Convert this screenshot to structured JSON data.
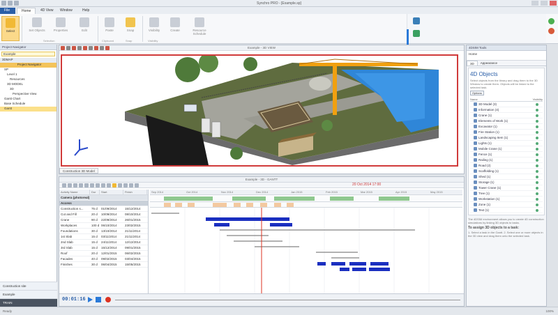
{
  "window": {
    "title": "Synchro PRO - [Example.sp]"
  },
  "ribbon": {
    "tabs": [
      "File",
      "Home",
      "4D View",
      "Window",
      "Help"
    ],
    "active_tab": "Home",
    "buttons": [
      "Select",
      "Set Objects",
      "Properties",
      "Edit",
      "Paste",
      "Snap",
      "Visibility",
      "Create",
      "Resource Schedule"
    ],
    "groups": [
      "Selection",
      "Clipboard",
      "Snap",
      "Visibility"
    ]
  },
  "left_panel": {
    "header": "Project Navigator",
    "search_value": "Example",
    "tree": [
      "3DMAP",
      "Project Navigator",
      "SP",
      "Level 1",
      "Resources",
      "3D MODEL",
      "3D",
      "Perspective View",
      "Gantt Chart",
      "Base Schedule",
      "Gantt"
    ],
    "bottom": [
      "Construction site",
      "Example",
      "TRAIN"
    ]
  },
  "view3d": {
    "title": "Example - 3D VIEW",
    "tab_label": "Construction 3D Model"
  },
  "gantt": {
    "title": "Example - 3D - GANTT",
    "current_date": "20 Oct 2014 17:00",
    "timecode": "00:01:16",
    "columns": [
      "Activity Name",
      "Dur",
      "Start",
      "Finish"
    ],
    "rows": [
      {
        "name": "Camera (photoreal)",
        "dur": "",
        "start": "",
        "finish": "",
        "style": "grp"
      },
      {
        "name": "Access",
        "dur": "",
        "start": "",
        "finish": "",
        "style": "sub"
      },
      {
        "name": "Construction s...",
        "dur": "75 d",
        "start": "01/09/2014",
        "finish": "15/12/2014",
        "style": ""
      },
      {
        "name": "Cut and Fill",
        "dur": "20 d",
        "start": "10/09/2014",
        "finish": "08/10/2014",
        "style": ""
      },
      {
        "name": "Crane",
        "dur": "90 d",
        "start": "22/09/2014",
        "finish": "26/01/2015",
        "style": ""
      },
      {
        "name": "Workplaces",
        "dur": "100 d",
        "start": "06/10/2014",
        "finish": "23/02/2015",
        "style": ""
      },
      {
        "name": "Foundations",
        "dur": "30 d",
        "start": "13/10/2014",
        "finish": "21/11/2014",
        "style": ""
      },
      {
        "name": "1st Slab",
        "dur": "15 d",
        "start": "03/11/2014",
        "finish": "21/11/2014",
        "style": ""
      },
      {
        "name": "2nd Slab",
        "dur": "15 d",
        "start": "24/11/2014",
        "finish": "12/12/2014",
        "style": ""
      },
      {
        "name": "3rd Slab",
        "dur": "15 d",
        "start": "15/12/2014",
        "finish": "09/01/2015",
        "style": ""
      },
      {
        "name": "Roof",
        "dur": "20 d",
        "start": "12/01/2015",
        "finish": "06/02/2015",
        "style": ""
      },
      {
        "name": "Facades",
        "dur": "40 d",
        "start": "09/02/2015",
        "finish": "03/04/2015",
        "style": ""
      },
      {
        "name": "Finishes",
        "dur": "30 d",
        "start": "06/04/2015",
        "finish": "15/05/2015",
        "style": ""
      }
    ],
    "months": [
      "Sep 2014",
      "Oct 2014",
      "Nov 2014",
      "Dec 2014",
      "Jan 2015",
      "Feb 2015",
      "Mar 2015",
      "Apr 2015",
      "May 2015"
    ]
  },
  "right_panel": {
    "header": "4DSIM Tools",
    "home_label": "Home",
    "tabs": [
      "3D",
      "Appearance"
    ],
    "title": "4D Objects",
    "text": "Select objects from the library and drag them to the 3D Window to create them. Objects will be linked to the selected task.",
    "button": "Options",
    "list_header": [
      "Name",
      "Visibility"
    ],
    "items": [
      "3D Model (3)",
      "Information (4)",
      "Crane (1)",
      "Elements of Work (1)",
      "Excavator (1)",
      "Fire Station (1)",
      "Landscaping Item (1)",
      "Lights (1)",
      "Mobile Crane (1)",
      "Fence (1)",
      "Railing (1)",
      "Road (2)",
      "Scaffolding (1)",
      "Shed (1)",
      "Storage (1)",
      "Tower Crane (1)",
      "Tree (1)",
      "Workstation (1)",
      "Zone (1)",
      "Text (1)"
    ],
    "help_text": "The 4DSIM environment allows you to create 4D construction simulations by linking 3D objects to tasks.",
    "help_heading": "To assign 3D objects to a task:",
    "help_steps": "1. Select a task in the Gantt. 2. Select one or more objects in the 3D view and drag them onto the selected task."
  },
  "status": {
    "left": "Ready",
    "right": "100%"
  },
  "colors": {
    "accent": "#2b5fa8",
    "select": "#fbd98a",
    "redframe": "#d03a3a",
    "bar": "#1a2fc0",
    "crane": "#f0a010"
  }
}
